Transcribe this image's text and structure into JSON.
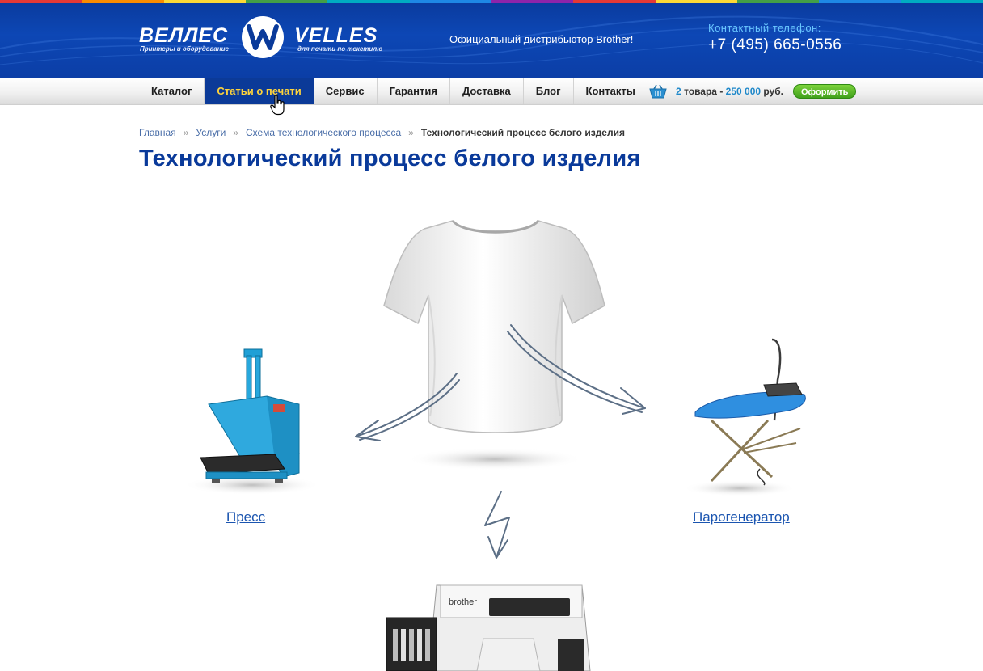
{
  "header": {
    "stripe_colors": [
      "#e53935",
      "#fb8c00",
      "#fdd835",
      "#43a047",
      "#00acc1",
      "#1e88e5",
      "#8e24aa",
      "#e53935",
      "#fdd835",
      "#43a047",
      "#1e88e5",
      "#00acc1"
    ],
    "logo": {
      "ru_name": "ВЕЛЛЕС",
      "ru_sub": "Принтеры и оборудование",
      "en_name": "VELLES",
      "en_sub": "для печати по текстилю"
    },
    "tagline": "Официальный дистрибьютор Brother!",
    "phone_label": "Контактный телефон:",
    "phone": "+7 (495) 665-0556"
  },
  "nav": {
    "items": [
      {
        "label": "Каталог",
        "active": false
      },
      {
        "label": "Статьи о печати",
        "active": true
      },
      {
        "label": "Сервис",
        "active": false
      },
      {
        "label": "Гарантия",
        "active": false
      },
      {
        "label": "Доставка",
        "active": false
      },
      {
        "label": "Блог",
        "active": false
      },
      {
        "label": "Контакты",
        "active": false
      }
    ]
  },
  "cart": {
    "count": "2",
    "count_label": "товара",
    "dash": "-",
    "total": "250 000",
    "currency": "руб.",
    "checkout_label": "Оформить"
  },
  "breadcrumb": {
    "items": [
      "Главная",
      "Услуги",
      "Схема технологического процесса"
    ],
    "separator": "»",
    "current": "Технологический процесс белого изделия"
  },
  "page_title": "Технологический процесс белого изделия",
  "diagram": {
    "center_item": "t-shirt-icon",
    "left_item": {
      "icon": "heat-press-icon",
      "label": "Пресс"
    },
    "right_item": {
      "icon": "steam-generator-icon",
      "label": "Парогенератор"
    },
    "bottom_item": {
      "icon": "printer-icon",
      "brand": "brother"
    }
  },
  "colors": {
    "brand_blue": "#0a3a9a",
    "nav_active_bg": "#0b3a98",
    "nav_active_text": "#ffd43b",
    "link": "#1b55b0",
    "checkout_green": "#41a11c"
  }
}
